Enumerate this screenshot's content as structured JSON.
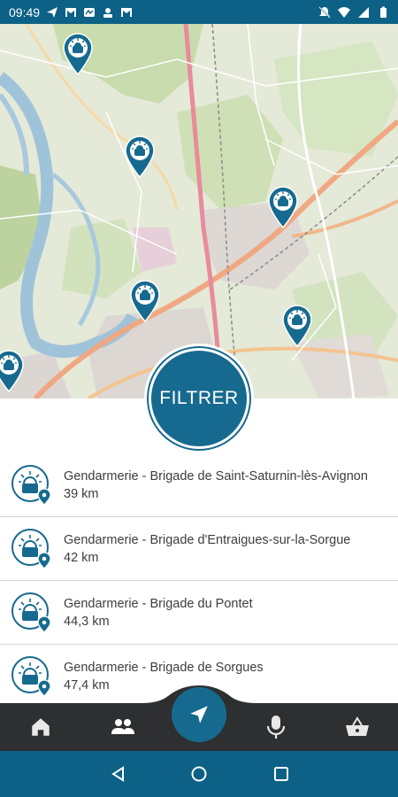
{
  "status_bar": {
    "time": "09:49",
    "notification_icons": [
      "send-icon",
      "gmail-icon",
      "messenger-icon",
      "notification-icon",
      "gmail-icon"
    ],
    "right_icons": [
      "mute-icon",
      "wifi-icon",
      "signal-icon",
      "battery-icon"
    ]
  },
  "map": {
    "pin_icon": "police-station-pin-icon",
    "pin_count": 6
  },
  "filter_button": {
    "label": "FILTRER"
  },
  "results": [
    {
      "name": "Gendarmerie - Brigade de Saint-Saturnin-lès-Avignon",
      "distance": "39 km"
    },
    {
      "name": "Gendarmerie - Brigade d'Entraigues-sur-la-Sorgue",
      "distance": "42 km"
    },
    {
      "name": "Gendarmerie - Brigade du Pontet",
      "distance": "44,3 km"
    },
    {
      "name": "Gendarmerie - Brigade de Sorgues",
      "distance": "47,4 km"
    }
  ],
  "bottom_nav": {
    "items": [
      "home-icon",
      "people-icon",
      "navigation-icon",
      "microphone-icon",
      "basket-icon"
    ],
    "active": "navigation-icon"
  },
  "system_nav": [
    "back-icon",
    "home-circle-icon",
    "recents-icon"
  ],
  "colors": {
    "primary": "#176a8f",
    "status_bar": "#0d6186",
    "nav_bar": "#2d2f31",
    "text": "#3d3d3d"
  }
}
